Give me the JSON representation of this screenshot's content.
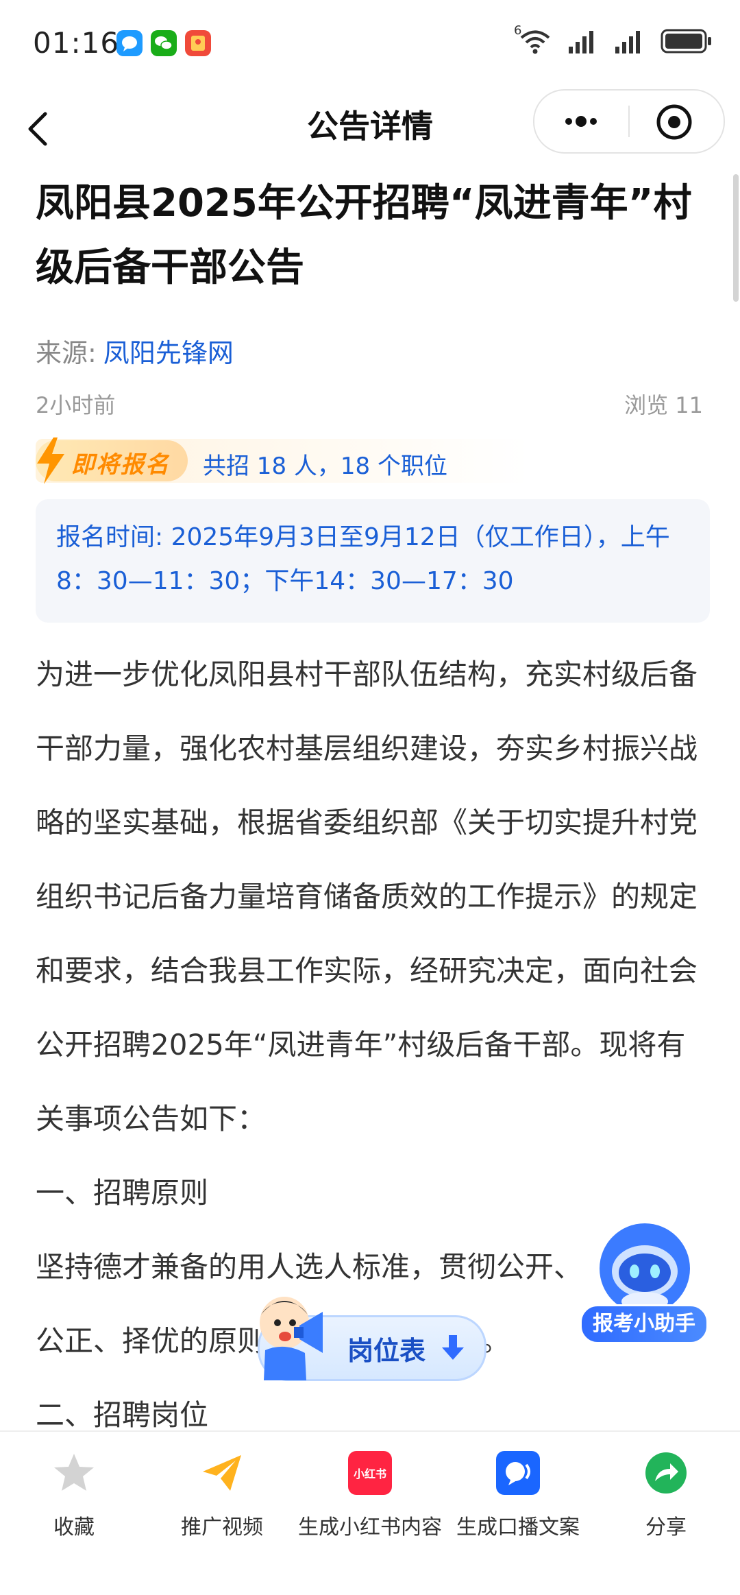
{
  "status_bar": {
    "time": "01:16",
    "network": "6"
  },
  "nav": {
    "title": "公告详情"
  },
  "article": {
    "title": "凤阳县2025年公开招聘“凤进青年”村级后备干部公告",
    "source_label": "来源:",
    "source_name": "凤阳先锋网",
    "time": "2小时前",
    "views": "浏览 11",
    "signup_badge": "即将报名",
    "recruit_summary": "共招 18 人，18 个职位",
    "signup_time": "报名时间: 2025年9月3日至9月12日（仅工作日），上午8：30—11：30；下午14：30—17：30",
    "paragraphs": [
      "为进一步优化凤阳县村干部队伍结构，充实村级后备干部力量，强化农村基层组织建设，夯实乡村振兴战略的坚实基础，根据省委组织部《关于切实提升村党组织书记后备力量培育储备质效的工作提示》的规定和要求，结合我县工作实际，经研究决定，面向社会公开招聘2025年“凤进青年”村级后备干部。现将有关事项公告如下：",
      "一、招聘原则",
      "坚持德才兼备的用人选人标准，贯彻公开、",
      "公正、择优的原则",
      "招聘。",
      "二、招聘岗位"
    ]
  },
  "floating": {
    "assistant_label": "报考小助手",
    "position_table_label": "岗位表"
  },
  "bottom_bar": {
    "items": [
      {
        "label": "收藏",
        "icon": "star-icon"
      },
      {
        "label": "推广视频",
        "icon": "paper-plane-icon"
      },
      {
        "label": "生成小红书内容",
        "icon": "xiaohongshu-icon",
        "icon_text": "小红书"
      },
      {
        "label": "生成口播文案",
        "icon": "speaker-icon"
      },
      {
        "label": "分享",
        "icon": "share-icon"
      }
    ]
  },
  "colors": {
    "accent_blue": "#1a5fd6",
    "orange": "#ff8a00",
    "green": "#22b45a",
    "red": "#ff2442"
  }
}
